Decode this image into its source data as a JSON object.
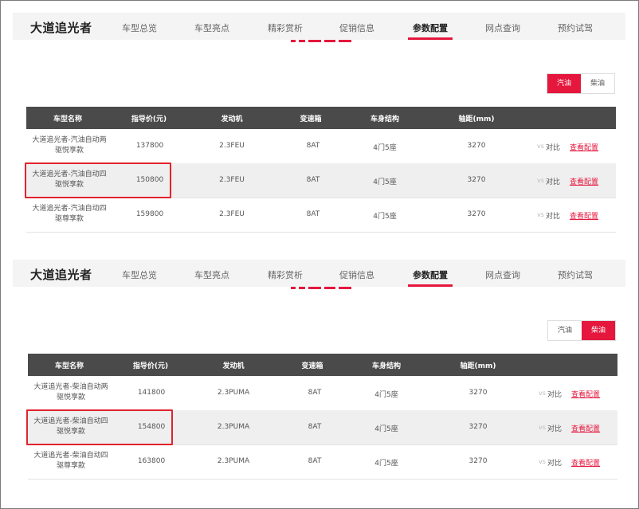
{
  "colors": {
    "accent": "#e5173d",
    "header_bg": "#4a4a4a",
    "nav_bg": "#f4f4f4",
    "highlight": "#e0242e"
  },
  "panels": [
    {
      "brand": "大道追光者",
      "nav": [
        "车型总览",
        "车型亮点",
        "精彩赏析",
        "促销信息",
        "参数配置",
        "网点查询",
        "预约试驾"
      ],
      "active_nav": "参数配置",
      "fuel": {
        "options": [
          "汽油",
          "柴油"
        ],
        "selected": "汽油"
      },
      "columns": [
        "车型名称",
        "指导价(元)",
        "发动机",
        "变速箱",
        "车身结构",
        "轴距(mm)"
      ],
      "rows": [
        {
          "name_line1": "大道追光者-汽油自动两",
          "name_line2": "驱悦享款",
          "price": "137800",
          "engine": "2.3FEU",
          "gearbox": "8AT",
          "body": "4门5座",
          "wheelbase": "3270",
          "vs": "vs",
          "compare": "对比",
          "config": "查看配置",
          "highlighted": false
        },
        {
          "name_line1": "大道追光者-汽油自动四",
          "name_line2": "驱悦享款",
          "price": "150800",
          "engine": "2.3FEU",
          "gearbox": "8AT",
          "body": "4门5座",
          "wheelbase": "3270",
          "vs": "vs",
          "compare": "对比",
          "config": "查看配置",
          "highlighted": true
        },
        {
          "name_line1": "大道追光者-汽油自动四",
          "name_line2": "驱尊享款",
          "price": "159800",
          "engine": "2.3FEU",
          "gearbox": "8AT",
          "body": "4门5座",
          "wheelbase": "3270",
          "vs": "vs",
          "compare": "对比",
          "config": "查看配置",
          "highlighted": false
        }
      ]
    },
    {
      "brand": "大道追光者",
      "nav": [
        "车型总览",
        "车型亮点",
        "精彩赏析",
        "促销信息",
        "参数配置",
        "网点查询",
        "预约试驾"
      ],
      "active_nav": "参数配置",
      "fuel": {
        "options": [
          "汽油",
          "柴油"
        ],
        "selected": "柴油"
      },
      "columns": [
        "车型名称",
        "指导价(元)",
        "发动机",
        "变速箱",
        "车身结构",
        "轴距(mm)"
      ],
      "rows": [
        {
          "name_line1": "大道追光者-柴油自动两",
          "name_line2": "驱悦享款",
          "price": "141800",
          "engine": "2.3PUMA",
          "gearbox": "8AT",
          "body": "4门5座",
          "wheelbase": "3270",
          "vs": "vs",
          "compare": "对比",
          "config": "查看配置",
          "highlighted": false
        },
        {
          "name_line1": "大道追光者-柴油自动四",
          "name_line2": "驱悦享款",
          "price": "154800",
          "engine": "2.3PUMA",
          "gearbox": "8AT",
          "body": "4门5座",
          "wheelbase": "3270",
          "vs": "vs",
          "compare": "对比",
          "config": "查看配置",
          "highlighted": true
        },
        {
          "name_line1": "大道追光者-柴油自动四",
          "name_line2": "驱尊享款",
          "price": "163800",
          "engine": "2.3PUMA",
          "gearbox": "8AT",
          "body": "4门5座",
          "wheelbase": "3270",
          "vs": "vs",
          "compare": "对比",
          "config": "查看配置",
          "highlighted": false
        }
      ]
    }
  ]
}
